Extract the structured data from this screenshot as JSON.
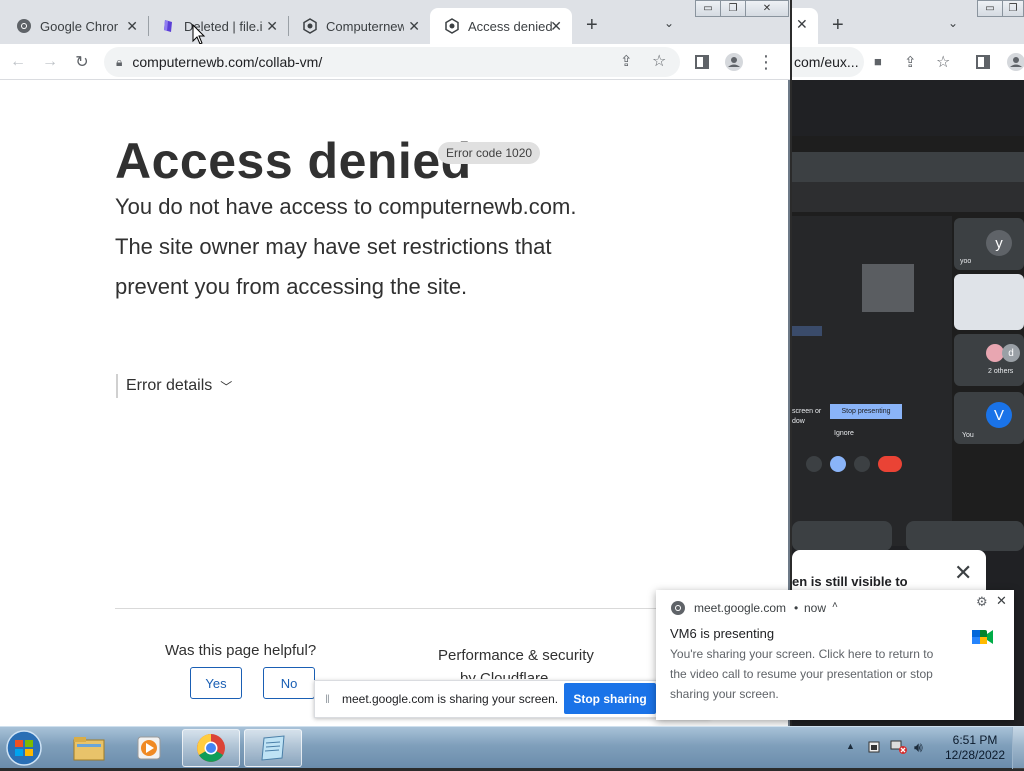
{
  "window_left": {
    "tabs": [
      {
        "label": "Google Chrome",
        "icon": "chrome-icon"
      },
      {
        "label": "Deleted | file.io",
        "icon": "file-io-icon"
      },
      {
        "label": "Computernewb",
        "icon": "computernewb-icon"
      },
      {
        "label": "Access denied",
        "icon": "computernewb-icon"
      }
    ],
    "new_tab_label": "+",
    "url": "computernewb.com/collab-vm/"
  },
  "page": {
    "title": "Access denied",
    "error_code": "Error code 1020",
    "lines": [
      "You do not have access to computernewb.com.",
      "The site owner may have set restrictions that",
      "prevent you from accessing the site."
    ],
    "error_details": "Error details",
    "helpful_question": "Was this page helpful?",
    "yes": "Yes",
    "no": "No",
    "perf": "Performance & security",
    "perf2": "by Cloudflare"
  },
  "sharing_bar": {
    "text": "meet.google.com is sharing your screen.",
    "stop": "Stop sharing"
  },
  "window_right": {
    "url": "com/eux...",
    "stop_presenting": "Stop presenting",
    "ignore": "Ignore",
    "screen_or": "screen or",
    "dow": "dow",
    "participants": [
      {
        "initial": "y",
        "label": "yoo",
        "color": "#5f6368"
      },
      {
        "initial": "V",
        "label": "You",
        "color": "#1a73e8"
      }
    ],
    "others_label": "2 others",
    "others_initial": "d",
    "still_visible": "en is still visible to"
  },
  "notification": {
    "source": "meet.google.com",
    "time": "now",
    "title": "VM6 is presenting",
    "body": "You're sharing your screen. Click here to return to the video call to resume your presentation or stop sharing your screen."
  },
  "taskbar": {
    "time": "6:51 PM",
    "date": "12/28/2022"
  }
}
